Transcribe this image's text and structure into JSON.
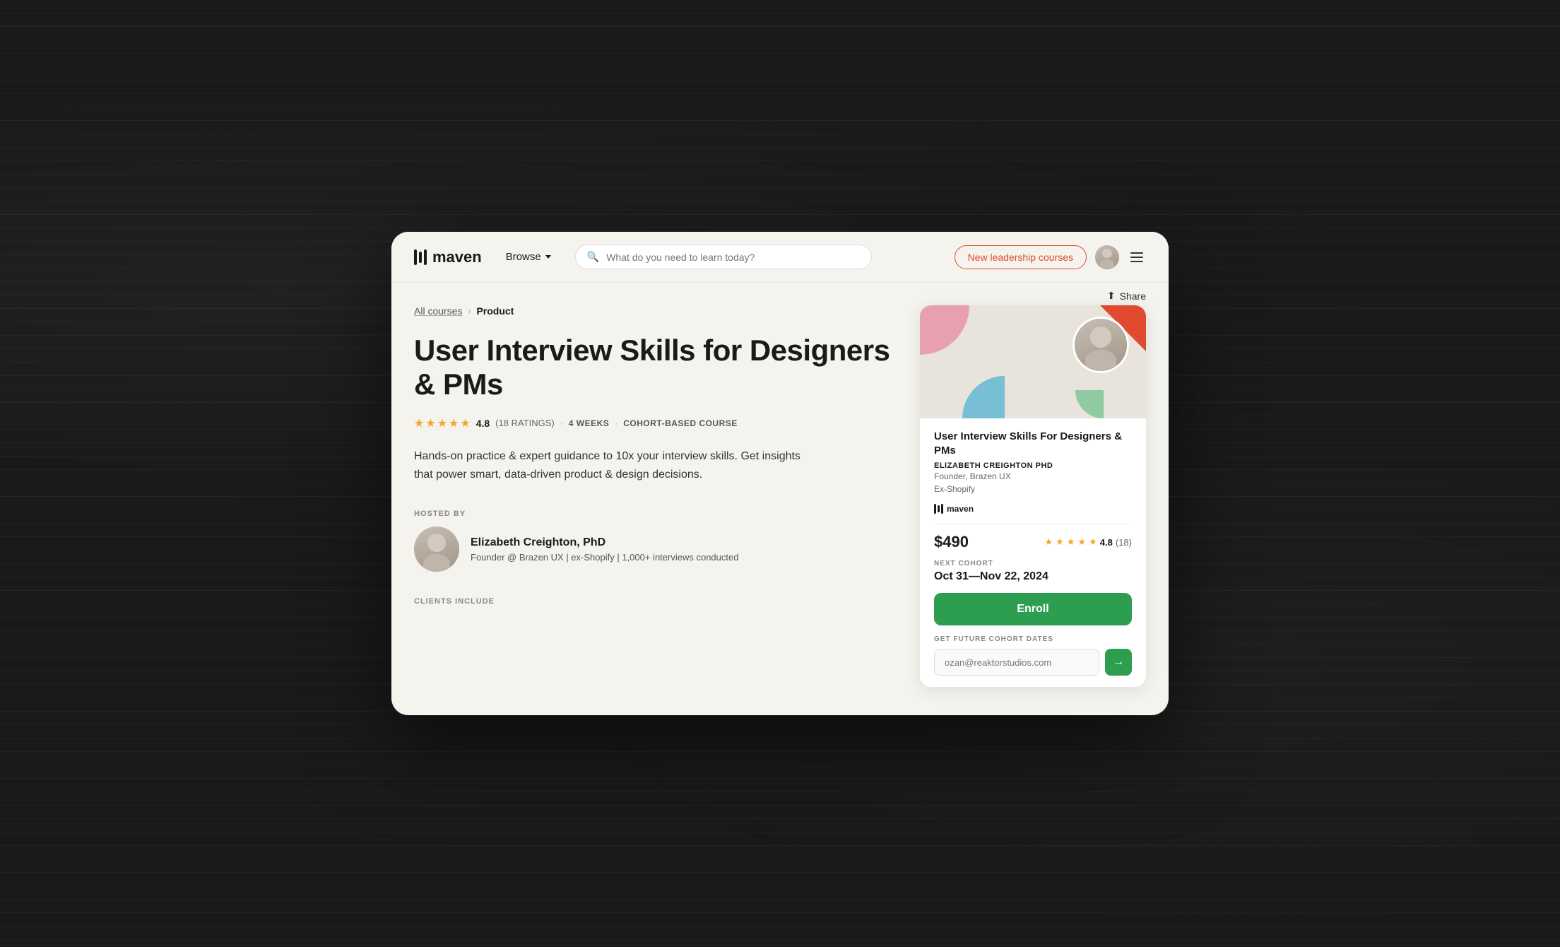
{
  "nav": {
    "logo_text": "maven",
    "browse_label": "Browse",
    "search_placeholder": "What do you need to learn today?",
    "leadership_btn_label": "New leadership courses",
    "menu_icon_label": "menu"
  },
  "breadcrumb": {
    "all_courses_label": "All courses",
    "separator": "›",
    "current_label": "Product"
  },
  "share": {
    "label": "Share"
  },
  "course": {
    "title": "User Interview Skills for Designers & PMs",
    "rating_num": "4.8",
    "rating_count": "(18 RATINGS)",
    "duration": "4 WEEKS",
    "course_type": "COHORT-BASED COURSE",
    "description": "Hands-on practice & expert guidance to 10x your interview skills. Get insights that power smart, data-driven product & design decisions.",
    "hosted_by_label": "HOSTED BY",
    "instructor_name": "Elizabeth Creighton, PhD",
    "instructor_bio": "Founder @ Brazen UX | ex-Shopify | 1,000+ interviews conducted",
    "clients_label": "CLIENTS INCLUDE"
  },
  "card": {
    "title": "User Interview Skills For Designers & PMs",
    "instructor_name": "ELIZABETH CREIGHTON PHD",
    "instructor_title_line1": "Founder, Brazen UX",
    "instructor_title_line2": "Ex-Shopify",
    "maven_logo": "maven",
    "price": "$490",
    "rating_num": "4.8",
    "rating_count": "(18)",
    "cohort_label": "NEXT COHORT",
    "cohort_date": "Oct 31—Nov 22, 2024",
    "enroll_label": "Enroll",
    "future_cohort_label": "GET FUTURE COHORT DATES",
    "email_placeholder": "ozan@reaktorstudios.com",
    "email_submit_arrow": "→"
  }
}
